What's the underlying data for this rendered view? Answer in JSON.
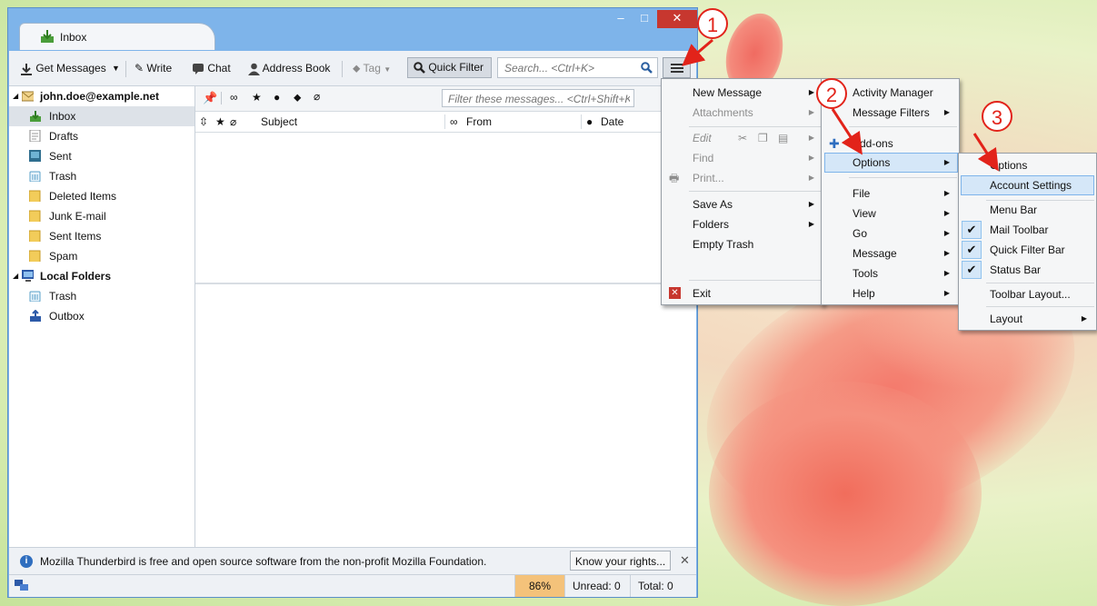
{
  "window": {
    "tab_title": "Inbox",
    "controls": {
      "minimize": "–",
      "maximize": "□",
      "close": "✕"
    }
  },
  "toolbar": {
    "get_messages": "Get Messages",
    "write": "Write",
    "chat": "Chat",
    "address_book": "Address Book",
    "tag": "Tag",
    "quick_filter": "Quick Filter",
    "search_placeholder": "Search... <Ctrl+K>"
  },
  "folders": {
    "account": "john.doe@example.net",
    "items": [
      "Inbox",
      "Drafts",
      "Sent",
      "Trash",
      "Deleted Items",
      "Junk E-mail",
      "Sent Items",
      "Spam"
    ],
    "local_folders": "Local Folders",
    "local_items": [
      "Trash",
      "Outbox"
    ]
  },
  "message_list": {
    "filter_placeholder": "Filter these messages... <Ctrl+Shift+K>",
    "columns": {
      "subject": "Subject",
      "from": "From",
      "date": "Date"
    }
  },
  "notice": {
    "text": "Mozilla Thunderbird is free and open source software from the non-profit Mozilla Foundation.",
    "button": "Know your rights..."
  },
  "status": {
    "zoom": "86%",
    "unread": "Unread: 0",
    "total": "Total: 0"
  },
  "app_menu": {
    "items": {
      "new_message": "New Message",
      "attachments": "Attachments",
      "edit": "Edit",
      "find": "Find",
      "print": "Print...",
      "save_as": "Save As",
      "folders": "Folders",
      "empty_trash": "Empty Trash",
      "exit": "Exit"
    }
  },
  "submenu": {
    "activity_manager": "Activity Manager",
    "message_filters": "Message Filters",
    "addons": "Add-ons",
    "options": "Options",
    "file": "File",
    "view": "View",
    "go": "Go",
    "message": "Message",
    "tools": "Tools",
    "help": "Help"
  },
  "options_menu": {
    "options": "Options",
    "account_settings": "Account Settings",
    "menu_bar": "Menu Bar",
    "mail_toolbar": "Mail Toolbar",
    "quick_filter_bar": "Quick Filter Bar",
    "status_bar": "Status Bar",
    "toolbar_layout": "Toolbar Layout...",
    "layout": "Layout"
  },
  "callouts": [
    "1",
    "2",
    "3"
  ],
  "colors": {
    "accent": "#7eb4ea",
    "callout": "#e2231a",
    "close": "#c7372f"
  }
}
